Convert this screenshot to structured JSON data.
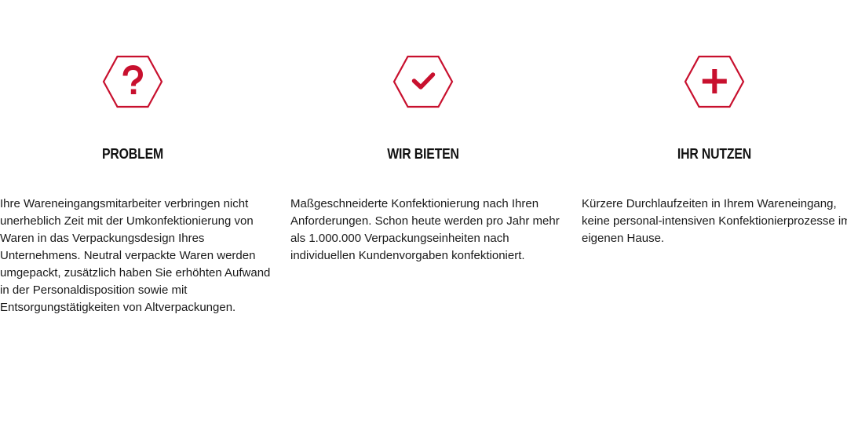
{
  "accent_color": "#c8102e",
  "columns": [
    {
      "icon": "question-mark-icon",
      "heading": "PROBLEM",
      "text": "Ihre Wareneingangsmitarbeiter verbringen nicht unerheblich Zeit mit der Umkonfektionierung von Waren in das Verpackungsdesign Ihres Unternehmens. Neutral verpackte Waren werden umgepackt, zusätzlich haben Sie erhöhten Aufwand in der Personaldisposition sowie mit Entsorgungstätigkeiten von Altverpackungen."
    },
    {
      "icon": "checkmark-icon",
      "heading": "WIR BIETEN",
      "text": "Maßgeschneiderte Konfektionierung nach Ihren Anforderungen. Schon heute werden pro Jahr mehr als 1.000.000 Verpackungseinheiten nach individuellen Kundenvorgaben konfektioniert."
    },
    {
      "icon": "plus-icon",
      "heading": "IHR NUTZEN",
      "text": "Kürzere Durchlaufzeiten in Ihrem Wareneingang, keine personal-intensiven Konfektionierprozesse im eigenen Hause."
    }
  ]
}
